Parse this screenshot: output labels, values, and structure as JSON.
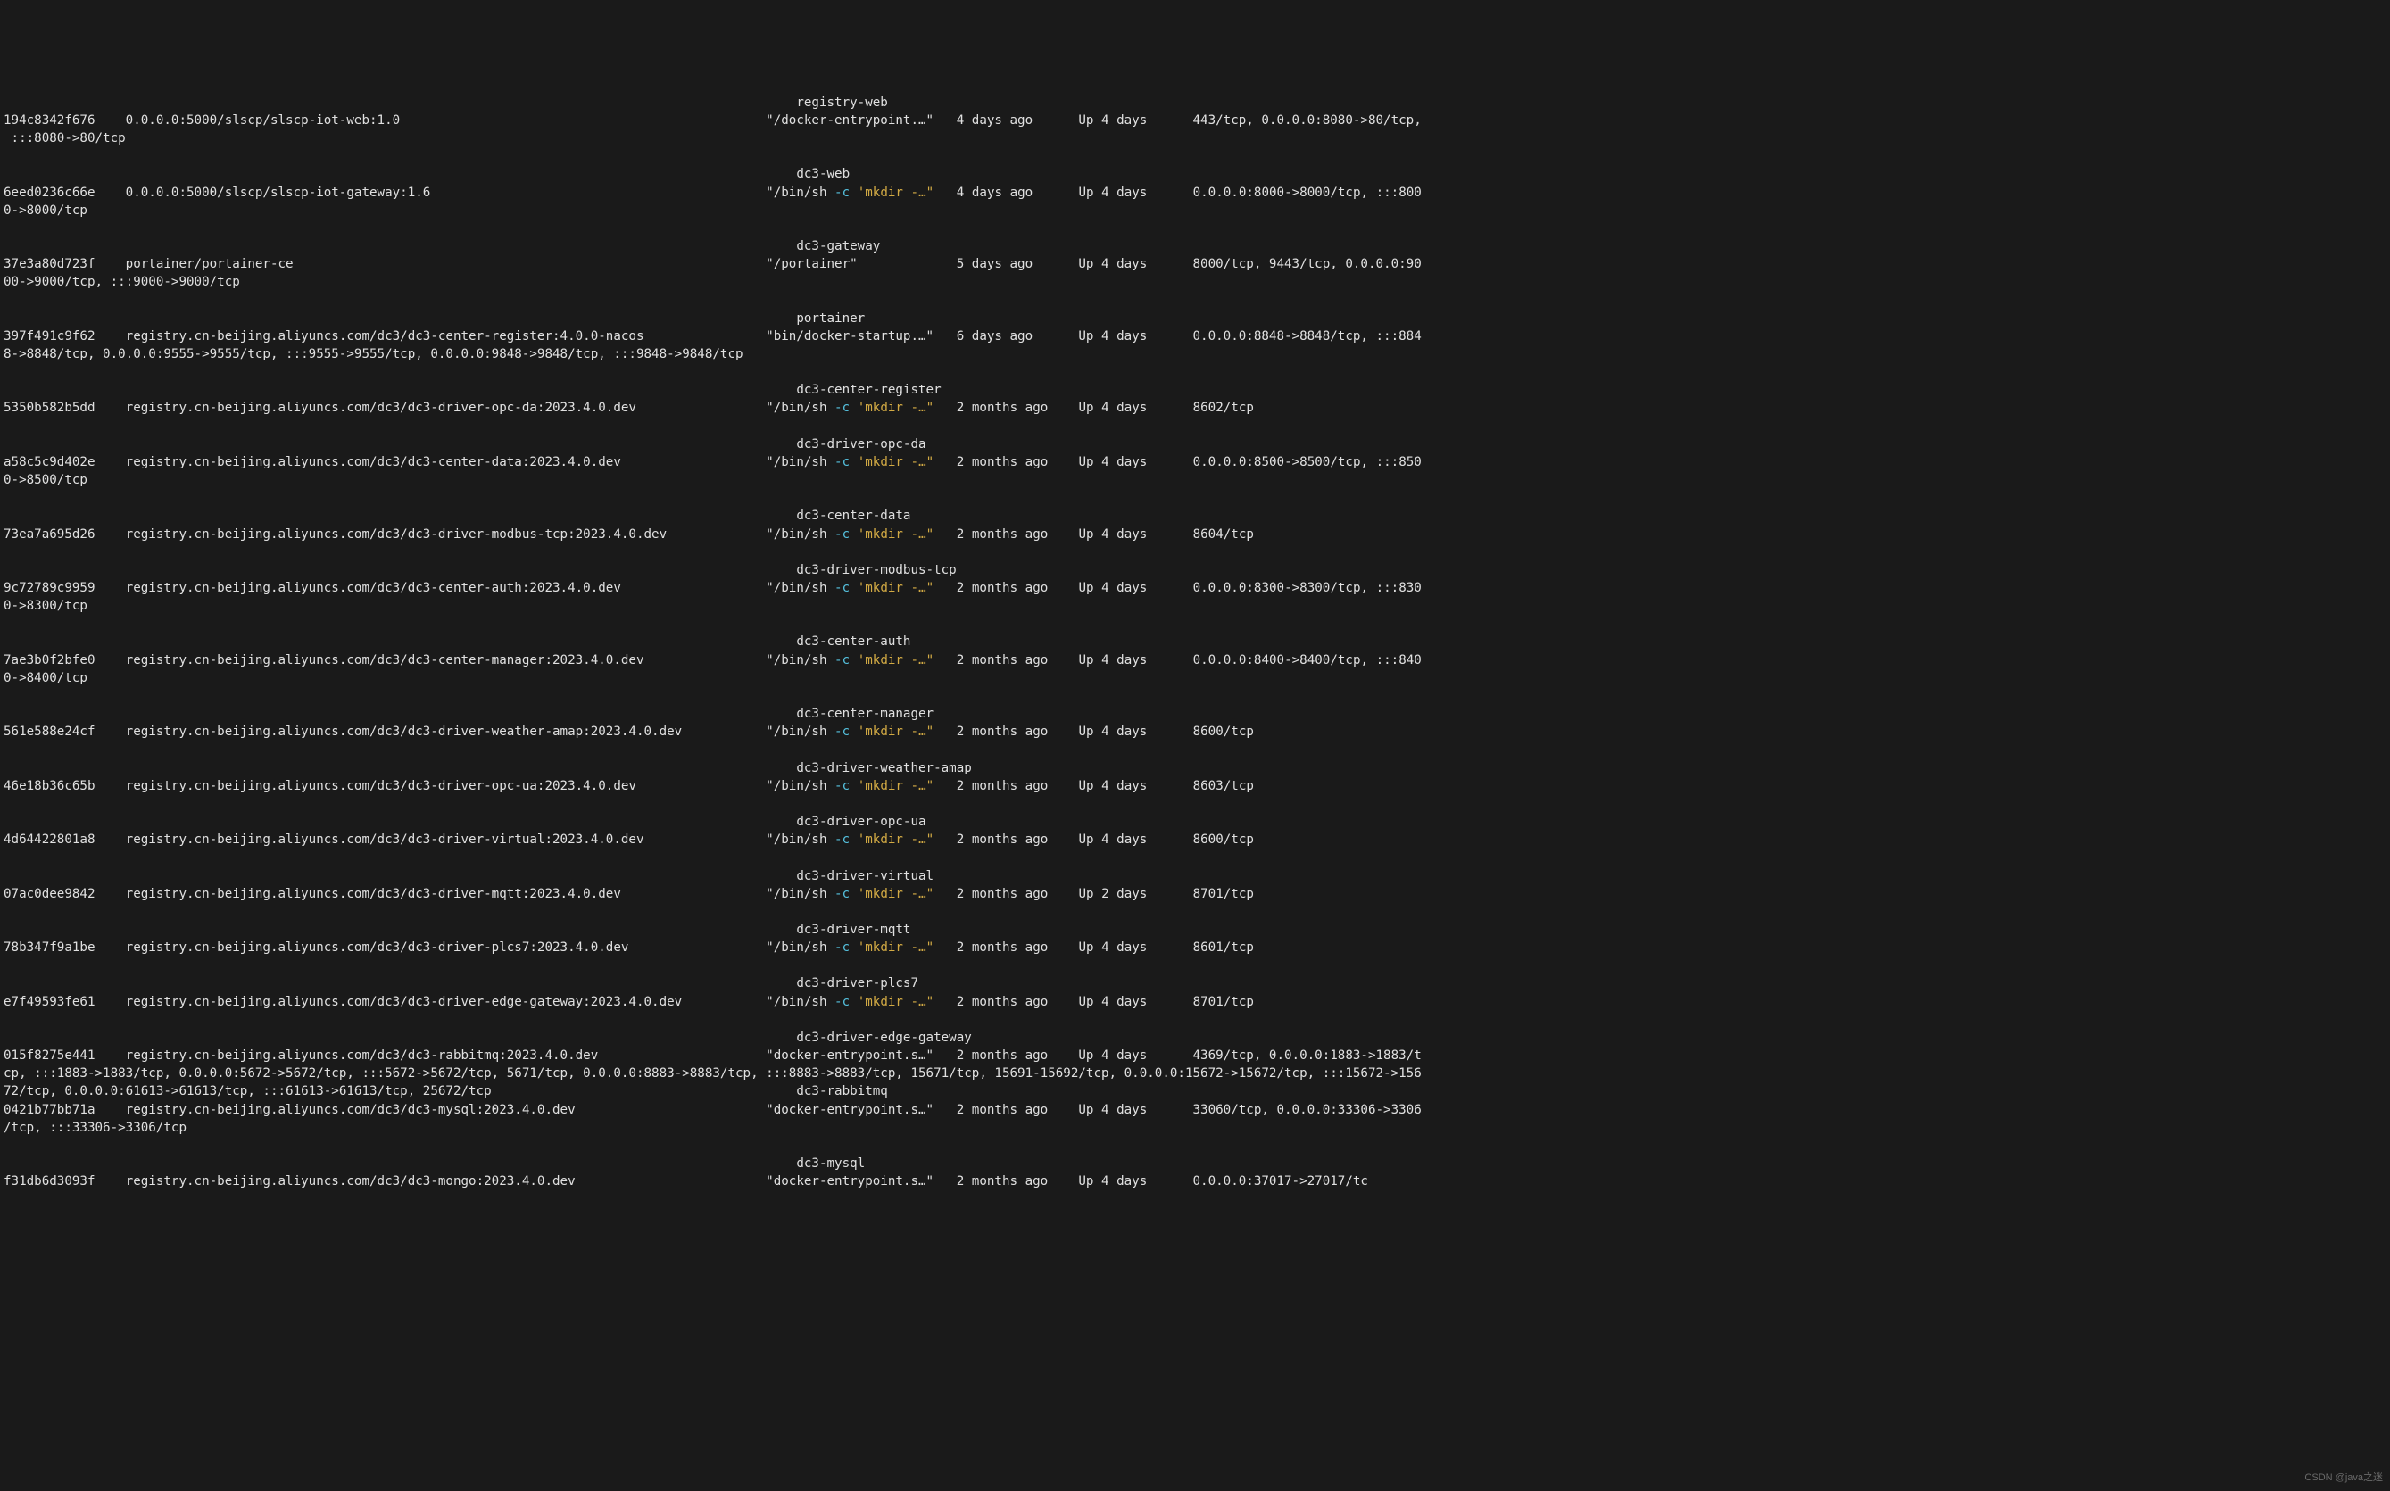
{
  "watermark": "CSDN @java之迷",
  "cols": {
    "id": 0,
    "image": 16,
    "cmd": 100,
    "created": 125,
    "status": 141,
    "ports": 156
  },
  "rows": [
    {
      "name": "registry-web",
      "id": "194c8342f676",
      "image": "0.0.0.0:5000/slscp/slscp-iot-web:1.0",
      "cmd": [
        "\"/docker-entrypoint.…\""
      ],
      "created": "4 days ago",
      "status": "Up 4 days",
      "ports": "443/tcp, 0.0.0.0:8080->80/tcp, :::8080->80/tcp"
    },
    {
      "name": "dc3-web",
      "id": "6eed0236c66e",
      "image": "0.0.0.0:5000/slscp/slscp-iot-gateway:1.6",
      "cmd": [
        "\"/bin/sh ",
        "-c",
        " ",
        "'mkdir -…\""
      ],
      "created": "4 days ago",
      "status": "Up 4 days",
      "ports": "0.0.0.0:8000->8000/tcp, :::8000->8000/tcp"
    },
    {
      "name": "dc3-gateway",
      "id": "37e3a80d723f",
      "image": "portainer/portainer-ce",
      "cmd": [
        "\"/portainer\""
      ],
      "created": "5 days ago",
      "status": "Up 4 days",
      "ports": "8000/tcp, 9443/tcp, 0.0.0.0:9000->9000/tcp, :::9000->9000/tcp"
    },
    {
      "name": "portainer",
      "id": "397f491c9f62",
      "image": "registry.cn-beijing.aliyuncs.com/dc3/dc3-center-register:4.0.0-nacos",
      "cmd": [
        "\"bin/docker-startup.…\""
      ],
      "created": "6 days ago",
      "status": "Up 4 days",
      "ports": "0.0.0.0:8848->8848/tcp, :::8848->8848/tcp, 0.0.0.0:9555->9555/tcp, :::9555->9555/tcp, 0.0.0.0:9848->9848/tcp, :::9848->9848/tcp"
    },
    {
      "name": "dc3-center-register",
      "id": "5350b582b5dd",
      "image": "registry.cn-beijing.aliyuncs.com/dc3/dc3-driver-opc-da:2023.4.0.dev",
      "cmd": [
        "\"/bin/sh ",
        "-c",
        " ",
        "'mkdir -…\""
      ],
      "created": "2 months ago",
      "status": "Up 4 days",
      "ports": "8602/tcp"
    },
    {
      "name": "dc3-driver-opc-da",
      "id": "a58c5c9d402e",
      "image": "registry.cn-beijing.aliyuncs.com/dc3/dc3-center-data:2023.4.0.dev",
      "cmd": [
        "\"/bin/sh ",
        "-c",
        " ",
        "'mkdir -…\""
      ],
      "created": "2 months ago",
      "status": "Up 4 days",
      "ports": "0.0.0.0:8500->8500/tcp, :::8500->8500/tcp"
    },
    {
      "name": "dc3-center-data",
      "id": "73ea7a695d26",
      "image": "registry.cn-beijing.aliyuncs.com/dc3/dc3-driver-modbus-tcp:2023.4.0.dev",
      "cmd": [
        "\"/bin/sh ",
        "-c",
        " ",
        "'mkdir -…\""
      ],
      "created": "2 months ago",
      "status": "Up 4 days",
      "ports": "8604/tcp"
    },
    {
      "name": "dc3-driver-modbus-tcp",
      "id": "9c72789c9959",
      "image": "registry.cn-beijing.aliyuncs.com/dc3/dc3-center-auth:2023.4.0.dev",
      "cmd": [
        "\"/bin/sh ",
        "-c",
        " ",
        "'mkdir -…\""
      ],
      "created": "2 months ago",
      "status": "Up 4 days",
      "ports": "0.0.0.0:8300->8300/tcp, :::8300->8300/tcp"
    },
    {
      "name": "dc3-center-auth",
      "id": "7ae3b0f2bfe0",
      "image": "registry.cn-beijing.aliyuncs.com/dc3/dc3-center-manager:2023.4.0.dev",
      "cmd": [
        "\"/bin/sh ",
        "-c",
        " ",
        "'mkdir -…\""
      ],
      "created": "2 months ago",
      "status": "Up 4 days",
      "ports": "0.0.0.0:8400->8400/tcp, :::8400->8400/tcp"
    },
    {
      "name": "dc3-center-manager",
      "id": "561e588e24cf",
      "image": "registry.cn-beijing.aliyuncs.com/dc3/dc3-driver-weather-amap:2023.4.0.dev",
      "cmd": [
        "\"/bin/sh ",
        "-c",
        " ",
        "'mkdir -…\""
      ],
      "created": "2 months ago",
      "status": "Up 4 days",
      "ports": "8600/tcp"
    },
    {
      "name": "dc3-driver-weather-amap",
      "id": "46e18b36c65b",
      "image": "registry.cn-beijing.aliyuncs.com/dc3/dc3-driver-opc-ua:2023.4.0.dev",
      "cmd": [
        "\"/bin/sh ",
        "-c",
        " ",
        "'mkdir -…\""
      ],
      "created": "2 months ago",
      "status": "Up 4 days",
      "ports": "8603/tcp"
    },
    {
      "name": "dc3-driver-opc-ua",
      "id": "4d64422801a8",
      "image": "registry.cn-beijing.aliyuncs.com/dc3/dc3-driver-virtual:2023.4.0.dev",
      "cmd": [
        "\"/bin/sh ",
        "-c",
        " ",
        "'mkdir -…\""
      ],
      "created": "2 months ago",
      "status": "Up 4 days",
      "ports": "8600/tcp"
    },
    {
      "name": "dc3-driver-virtual",
      "id": "07ac0dee9842",
      "image": "registry.cn-beijing.aliyuncs.com/dc3/dc3-driver-mqtt:2023.4.0.dev",
      "cmd": [
        "\"/bin/sh ",
        "-c",
        " ",
        "'mkdir -…\""
      ],
      "created": "2 months ago",
      "status": "Up 2 days",
      "ports": "8701/tcp"
    },
    {
      "name": "dc3-driver-mqtt",
      "id": "78b347f9a1be",
      "image": "registry.cn-beijing.aliyuncs.com/dc3/dc3-driver-plcs7:2023.4.0.dev",
      "cmd": [
        "\"/bin/sh ",
        "-c",
        " ",
        "'mkdir -…\""
      ],
      "created": "2 months ago",
      "status": "Up 4 days",
      "ports": "8601/tcp"
    },
    {
      "name": "dc3-driver-plcs7",
      "id": "e7f49593fe61",
      "image": "registry.cn-beijing.aliyuncs.com/dc3/dc3-driver-edge-gateway:2023.4.0.dev",
      "cmd": [
        "\"/bin/sh ",
        "-c",
        " ",
        "'mkdir -…\""
      ],
      "created": "2 months ago",
      "status": "Up 4 days",
      "ports": "8701/tcp"
    },
    {
      "name": "dc3-driver-edge-gateway",
      "id": "015f8275e441",
      "image": "registry.cn-beijing.aliyuncs.com/dc3/dc3-rabbitmq:2023.4.0.dev",
      "cmd": [
        "\"docker-entrypoint.s…\""
      ],
      "created": "2 months ago",
      "status": "Up 4 days",
      "ports": "4369/tcp, 0.0.0.0:1883->1883/tcp, :::1883->1883/tcp, 0.0.0.0:5672->5672/tcp, :::5672->5672/tcp, 5671/tcp, 0.0.0.0:8883->8883/tcp, :::8883->8883/tcp, 15671/tcp, 15691-15692/tcp, 0.0.0.0:15672->15672/tcp, :::15672->15672/tcp, 0.0.0.0:61613->61613/tcp, :::61613->61613/tcp, 25672/tcp",
      "trailName": "dc3-rabbitmq",
      "noBlankAfter": true
    },
    {
      "id": "0421b77bb71a",
      "image": "registry.cn-beijing.aliyuncs.com/dc3/dc3-mysql:2023.4.0.dev",
      "cmd": [
        "\"docker-entrypoint.s…\""
      ],
      "created": "2 months ago",
      "status": "Up 4 days",
      "ports": "33060/tcp, 0.0.0.0:33306->3306/tcp, :::33306->3306/tcp"
    },
    {
      "name": "dc3-mysql",
      "id": "f31db6d3093f",
      "image": "registry.cn-beijing.aliyuncs.com/dc3/dc3-mongo:2023.4.0.dev",
      "cmd": [
        "\"docker-entrypoint.s…\""
      ],
      "created": "2 months ago",
      "status": "Up 4 days",
      "ports": "0.0.0.0:37017->27017/tc"
    }
  ]
}
